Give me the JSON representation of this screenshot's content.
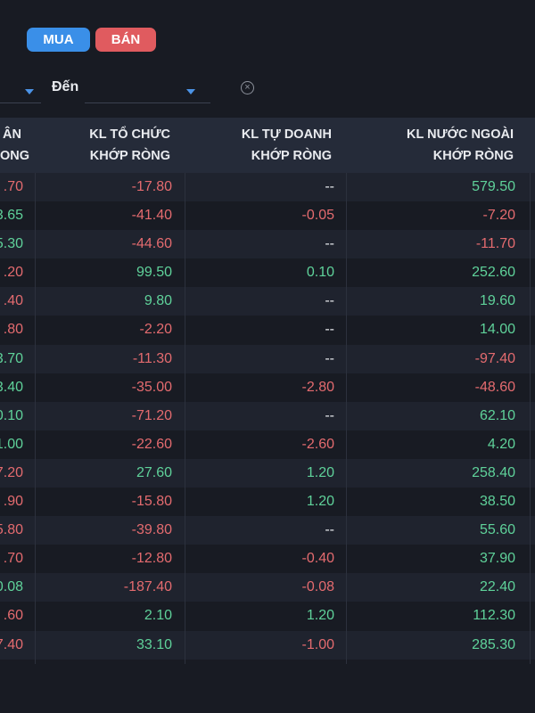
{
  "buttons": {
    "buy": "MUA",
    "sell": "BÁN"
  },
  "filter": {
    "to_label": "Đến",
    "clear_icon": "close-circle-icon"
  },
  "columns": [
    {
      "line1": "ÂN",
      "line2": "ONG"
    },
    {
      "line1": "KL TỔ CHỨC",
      "line2": "KHỚP RÒNG"
    },
    {
      "line1": "KL TỰ DOANH",
      "line2": "KHỚP RÒNG"
    },
    {
      "line1": "KL NƯỚC NGOÀI",
      "line2": "KHỚP RÒNG"
    }
  ],
  "rows": [
    {
      "c0": ".70",
      "c0s": "neg",
      "c1": "-17.80",
      "c1s": "neg",
      "c2": "--",
      "c2s": "neu",
      "c3": "579.50",
      "c3s": "pos"
    },
    {
      "c0": "3.65",
      "c0s": "pos",
      "c1": "-41.40",
      "c1s": "neg",
      "c2": "-0.05",
      "c2s": "neg",
      "c3": "-7.20",
      "c3s": "neg"
    },
    {
      "c0": "5.30",
      "c0s": "pos",
      "c1": "-44.60",
      "c1s": "neg",
      "c2": "--",
      "c2s": "neu",
      "c3": "-11.70",
      "c3s": "neg"
    },
    {
      "c0": ".20",
      "c0s": "neg",
      "c1": "99.50",
      "c1s": "pos",
      "c2": "0.10",
      "c2s": "pos",
      "c3": "252.60",
      "c3s": "pos"
    },
    {
      "c0": ".40",
      "c0s": "neg",
      "c1": "9.80",
      "c1s": "pos",
      "c2": "--",
      "c2s": "neu",
      "c3": "19.60",
      "c3s": "pos"
    },
    {
      "c0": ".80",
      "c0s": "neg",
      "c1": "-2.20",
      "c1s": "neg",
      "c2": "--",
      "c2s": "neu",
      "c3": "14.00",
      "c3s": "pos"
    },
    {
      "c0": "3.70",
      "c0s": "pos",
      "c1": "-11.30",
      "c1s": "neg",
      "c2": "--",
      "c2s": "neu",
      "c3": "-97.40",
      "c3s": "neg"
    },
    {
      "c0": "3.40",
      "c0s": "pos",
      "c1": "-35.00",
      "c1s": "neg",
      "c2": "-2.80",
      "c2s": "neg",
      "c3": "-48.60",
      "c3s": "neg"
    },
    {
      "c0": "0.10",
      "c0s": "pos",
      "c1": "-71.20",
      "c1s": "neg",
      "c2": "--",
      "c2s": "neu",
      "c3": "62.10",
      "c3s": "pos"
    },
    {
      "c0": "1.00",
      "c0s": "pos",
      "c1": "-22.60",
      "c1s": "neg",
      "c2": "-2.60",
      "c2s": "neg",
      "c3": "4.20",
      "c3s": "pos"
    },
    {
      "c0": "7.20",
      "c0s": "neg",
      "c1": "27.60",
      "c1s": "pos",
      "c2": "1.20",
      "c2s": "pos",
      "c3": "258.40",
      "c3s": "pos"
    },
    {
      "c0": ".90",
      "c0s": "neg",
      "c1": "-15.80",
      "c1s": "neg",
      "c2": "1.20",
      "c2s": "pos",
      "c3": "38.50",
      "c3s": "pos"
    },
    {
      "c0": "5.80",
      "c0s": "neg",
      "c1": "-39.80",
      "c1s": "neg",
      "c2": "--",
      "c2s": "neu",
      "c3": "55.60",
      "c3s": "pos"
    },
    {
      "c0": ".70",
      "c0s": "neg",
      "c1": "-12.80",
      "c1s": "neg",
      "c2": "-0.40",
      "c2s": "neg",
      "c3": "37.90",
      "c3s": "pos"
    },
    {
      "c0": "0.08",
      "c0s": "pos",
      "c1": "-187.40",
      "c1s": "neg",
      "c2": "-0.08",
      "c2s": "neg",
      "c3": "22.40",
      "c3s": "pos"
    },
    {
      "c0": ".60",
      "c0s": "neg",
      "c1": "2.10",
      "c1s": "pos",
      "c2": "1.20",
      "c2s": "pos",
      "c3": "112.30",
      "c3s": "pos"
    },
    {
      "c0": "7.40",
      "c0s": "neg",
      "c1": "33.10",
      "c1s": "pos",
      "c2": "-1.00",
      "c2s": "neg",
      "c3": "285.30",
      "c3s": "pos"
    }
  ]
}
